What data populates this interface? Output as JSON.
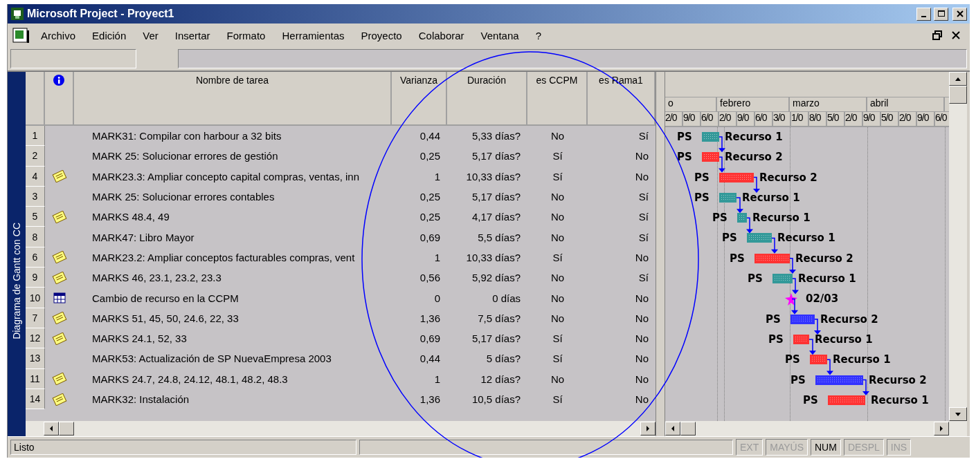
{
  "window": {
    "title": "Microsoft Project - Proyect1"
  },
  "menu": [
    {
      "label": "Archivo"
    },
    {
      "label": "Edición"
    },
    {
      "label": "Ver"
    },
    {
      "label": "Insertar"
    },
    {
      "label": "Formato"
    },
    {
      "label": "Herramientas"
    },
    {
      "label": "Proyecto"
    },
    {
      "label": "Colaborar"
    },
    {
      "label": "Ventana"
    },
    {
      "label": "?"
    }
  ],
  "view_bar": {
    "label": "Diagrama de Gantt con CC"
  },
  "table": {
    "columns": [
      "Varianza",
      "Duración",
      "es CCPM",
      "es Rama1"
    ],
    "name_column": "Nombre de tarea",
    "rows": [
      {
        "id": "1",
        "kind": "plain",
        "name": "MARK31: Compilar con harbour a 32 bits",
        "values": [
          "0,44",
          "5,33 días?",
          "No",
          "Sí"
        ],
        "gantt": {
          "kind": "bar",
          "prefix": "PS",
          "color": "#339999",
          "label": "Recurso 1"
        }
      },
      {
        "id": "2",
        "kind": "plain",
        "name": "MARK 25: Solucionar errores de gestión",
        "values": [
          "0,25",
          "5,17 días?",
          "Sí",
          "No"
        ],
        "gantt": {
          "kind": "bar",
          "prefix": "PS",
          "color": "#ff3333",
          "label": "Recurso 2"
        }
      },
      {
        "id": "4",
        "kind": "note",
        "name": "MARK23.3: Ampliar concepto capital compras, ventas, inn",
        "values": [
          "1",
          "10,33 días?",
          "Sí",
          "No"
        ],
        "gantt": {
          "kind": "bar",
          "prefix": "PS",
          "color": "#ff3333",
          "label": "Recurso 2"
        }
      },
      {
        "id": "3",
        "kind": "plain",
        "name": "MARK 25: Solucionar errores contables",
        "values": [
          "0,25",
          "5,17 días?",
          "No",
          "Sí"
        ],
        "gantt": {
          "kind": "bar",
          "prefix": "PS",
          "color": "#339999",
          "label": "Recurso 1"
        }
      },
      {
        "id": "5",
        "kind": "note",
        "name": "MARKS 48.4, 49",
        "values": [
          "0,25",
          "4,17 días?",
          "No",
          "Sí"
        ],
        "gantt": {
          "kind": "bar",
          "prefix": "PS",
          "color": "#339999",
          "label": "Recurso 1"
        }
      },
      {
        "id": "8",
        "kind": "plain",
        "name": "MARK47: Libro Mayor",
        "values": [
          "0,69",
          "5,5 días?",
          "No",
          "Sí"
        ],
        "gantt": {
          "kind": "bar",
          "prefix": "PS",
          "color": "#339999",
          "label": "Recurso 1"
        }
      },
      {
        "id": "6",
        "kind": "note",
        "name": "MARK23.2: Ampliar conceptos facturables compras, vent",
        "values": [
          "1",
          "10,33 días?",
          "Sí",
          "No"
        ],
        "gantt": {
          "kind": "bar",
          "prefix": "PS",
          "color": "#ff3333",
          "label": "Recurso 2"
        }
      },
      {
        "id": "9",
        "kind": "note",
        "name": "MARKS 46, 23.1, 23.2, 23.3",
        "values": [
          "0,56",
          "5,92 días?",
          "No",
          "Sí"
        ],
        "gantt": {
          "kind": "bar",
          "prefix": "PS",
          "color": "#339999",
          "label": "Recurso 1"
        }
      },
      {
        "id": "10",
        "kind": "calendar",
        "name": "Cambio de recurso en la CCPM",
        "values": [
          "0",
          "0 días",
          "No",
          "No"
        ],
        "gantt": {
          "kind": "milestone",
          "color": "#ff00ff",
          "label": "02/03"
        }
      },
      {
        "id": "7",
        "kind": "note",
        "name": "MARKS 51, 45, 50, 24.6, 22, 33",
        "values": [
          "1,36",
          "7,5 días?",
          "No",
          "No"
        ],
        "gantt": {
          "kind": "bar",
          "prefix": "PS",
          "color": "#3333ff",
          "label": "Recurso 2"
        }
      },
      {
        "id": "12",
        "kind": "note",
        "name": "MARKS 24.1, 52, 33",
        "values": [
          "0,69",
          "5,17 días?",
          "Sí",
          "No"
        ],
        "gantt": {
          "kind": "bar",
          "prefix": "PS",
          "color": "#ff3333",
          "label": "Recurso 1"
        }
      },
      {
        "id": "13",
        "kind": "plain",
        "name": "MARK53: Actualización de SP NuevaEmpresa 2003",
        "values": [
          "0,44",
          "5 días?",
          "Sí",
          "No"
        ],
        "gantt": {
          "kind": "bar",
          "prefix": "PS",
          "color": "#ff3333",
          "label": "Recurso 1"
        }
      },
      {
        "id": "11",
        "kind": "note",
        "name": "MARKS 24.7, 24.8, 24.12, 48.1, 48.2, 48.3",
        "values": [
          "1",
          "12 días?",
          "No",
          "No"
        ],
        "gantt": {
          "kind": "bar",
          "prefix": "PS",
          "color": "#3333ff",
          "label": "Recurso 2"
        }
      },
      {
        "id": "14",
        "kind": "note",
        "name": "MARK32: Instalación",
        "values": [
          "1,36",
          "10,5 días?",
          "Sí",
          "No"
        ],
        "gantt": {
          "kind": "bar",
          "prefix": "PS",
          "color": "#ff3333",
          "label": "Recurso 1"
        }
      }
    ]
  },
  "timescale": {
    "months": [
      "o",
      "febrero",
      "marzo",
      "abril"
    ],
    "weeks": [
      "2/0",
      "9/0",
      "6/0",
      "2/0",
      "9/0",
      "6/0",
      "3/0",
      "1/0",
      "8/0",
      "5/0",
      "2/0",
      "9/0",
      "5/0",
      "2/0",
      "9/0",
      "6/0"
    ]
  },
  "status_bar": {
    "text": "Listo",
    "indicators": [
      {
        "label": "EXT",
        "on": false
      },
      {
        "label": "MAYÚS",
        "on": false
      },
      {
        "label": "NUM",
        "on": true
      },
      {
        "label": "DESPL",
        "on": false
      },
      {
        "label": "INS",
        "on": false
      }
    ]
  }
}
